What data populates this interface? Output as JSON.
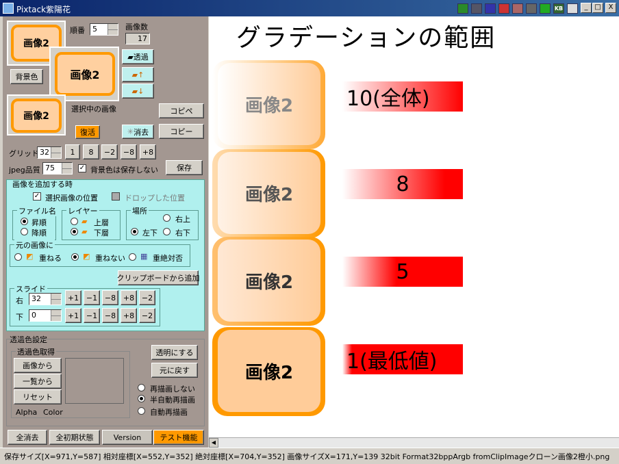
{
  "window": {
    "title": "Pixtack紫陽花",
    "buttons": {
      "min": "_",
      "max": "□",
      "close": "X"
    }
  },
  "tray": [
    "tray-icon-1",
    "tray-icon-2",
    "tray-icon-3",
    "tray-icon-4",
    "tray-icon-5",
    "tray-icon-6",
    "tray-icon-7",
    "KB",
    "tray-icon-9"
  ],
  "left": {
    "thumb_label": "画像2",
    "order_label": "順番",
    "order_value": "5",
    "count_label": "画像数",
    "count_value": "17",
    "bg_color_button": "背景色",
    "transparent_button": "透過",
    "selected_label": "選択中の画像",
    "copy_paste": "コピペ",
    "copy": "コピー",
    "restore": "復活",
    "delete": "消去",
    "grid_label": "グリッド",
    "grid_value": "32",
    "grid_buttons": [
      "1",
      "8",
      "−2",
      "−8",
      "+8"
    ],
    "jpeg_label": "jpeg品質",
    "jpeg_value": "75",
    "bg_no_save": "背景色は保存しない",
    "save": "保存"
  },
  "add": {
    "title": "画像を追加する時",
    "selected_pos": "選択画像の位置",
    "drop_pos": "ドロップした位置",
    "filename_title": "ファイル名",
    "asc": "昇順",
    "desc": "降順",
    "layer_title": "レイヤー",
    "upper": "上層",
    "lower": "下層",
    "place_title": "場所",
    "top_right": "右上",
    "bottom_left": "左下",
    "bottom_right": "右下",
    "original_title": "元の画像に",
    "overlap": "重ねる",
    "no_overlap": "重ねない",
    "never_overlap": "重絶対否",
    "clipboard": "クリップボードから追加",
    "slide_title": "スライド",
    "right_label": "右",
    "right_value": "32",
    "down_label": "下",
    "down_value": "0",
    "slide_buttons": [
      "+1",
      "−1",
      "−8",
      "+8",
      "−2"
    ]
  },
  "trans": {
    "title": "透過色設定",
    "pick_title": "透過色取得",
    "from_image": "画像から",
    "from_list": "一覧から",
    "reset": "リセット",
    "alpha": "Alpha",
    "color": "Color",
    "make_transparent": "透明にする",
    "revert": "元に戻す",
    "no_redraw": "再描画しない",
    "semi_auto": "半自動再描画",
    "auto": "自動再描画"
  },
  "tabs": [
    "全消去",
    "全初期状態",
    "Version",
    "テスト機能"
  ],
  "canvas": {
    "heading": "グラデーションの範囲",
    "tile_label": "画像2",
    "bars": [
      "10(全体)",
      "8",
      "5",
      "1(最低値)"
    ]
  },
  "status": "保存サイズ[X=971,Y=587] 相対座標[X=552,Y=352] 絶対座標[X=704,Y=352] 画像サイズX=171,Y=139 32bit Format32bppArgb fromClipImageクローン画像2橙小.png",
  "colors": {
    "accent": "#ff9900",
    "panel": "#a39791",
    "group": "#b0f0ee",
    "bar_end": "#ff0000"
  }
}
